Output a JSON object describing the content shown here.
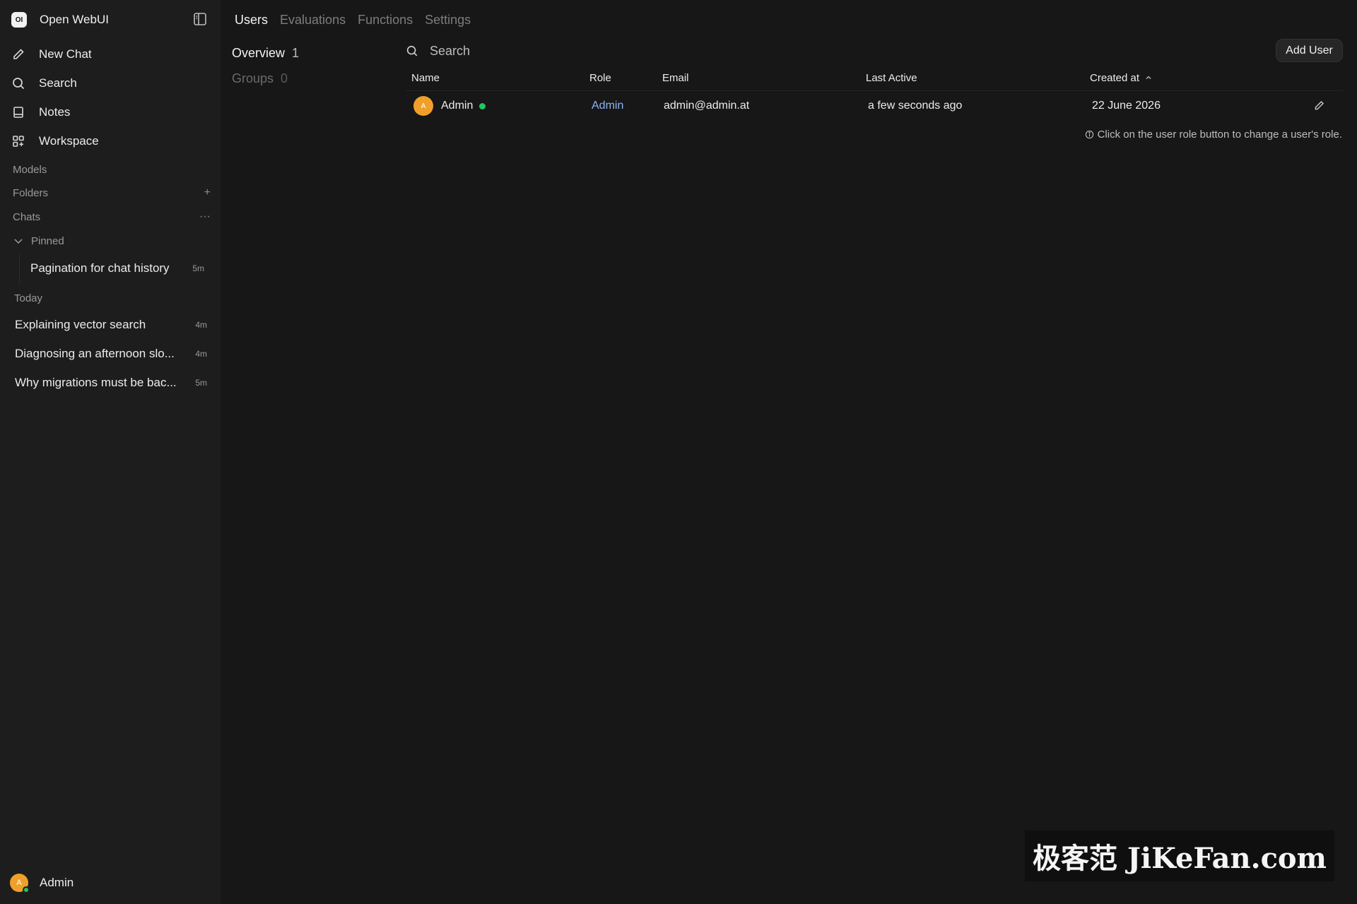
{
  "app": {
    "name": "Open WebUI",
    "logo_text": "OI"
  },
  "sidebar": {
    "nav": [
      {
        "label": "New Chat",
        "icon": "pencil-icon"
      },
      {
        "label": "Search",
        "icon": "search-icon"
      },
      {
        "label": "Notes",
        "icon": "notes-icon"
      },
      {
        "label": "Workspace",
        "icon": "workspace-icon"
      }
    ],
    "sections": {
      "models": "Models",
      "folders": "Folders",
      "chats": "Chats"
    },
    "pinned_label": "Pinned",
    "pinned_chats": [
      {
        "title": "Pagination for chat history",
        "age": "5m"
      }
    ],
    "today_label": "Today",
    "today_chats": [
      {
        "title": "Explaining vector search",
        "age": "4m"
      },
      {
        "title": "Diagnosing an afternoon slo...",
        "age": "4m"
      },
      {
        "title": "Why migrations must be bac...",
        "age": "5m"
      }
    ],
    "user": {
      "initial": "A",
      "name": "Admin"
    }
  },
  "main": {
    "tabs": [
      "Users",
      "Evaluations",
      "Functions",
      "Settings"
    ],
    "active_tab": "Users",
    "subnav": [
      {
        "label": "Overview",
        "count": "1"
      },
      {
        "label": "Groups",
        "count": "0"
      }
    ],
    "search": {
      "placeholder": "Search"
    },
    "add_user_label": "Add User",
    "table": {
      "columns": [
        "Name",
        "Role",
        "Email",
        "Last Active",
        "Created at"
      ],
      "rows": [
        {
          "initial": "A",
          "name": "Admin",
          "role": "Admin",
          "email": "admin@admin.at",
          "last_active": "a few seconds ago",
          "created": "22 June 2026"
        }
      ]
    },
    "hint": "Click on the user role button to change a user's role."
  },
  "watermark": "极客范 JiKeFan.com",
  "colors": {
    "accent_avatar": "#f0a02a",
    "online": "#22c55e",
    "role_link": "#8fb4f2",
    "background": "#171717",
    "sidebar": "#1d1d1d"
  }
}
